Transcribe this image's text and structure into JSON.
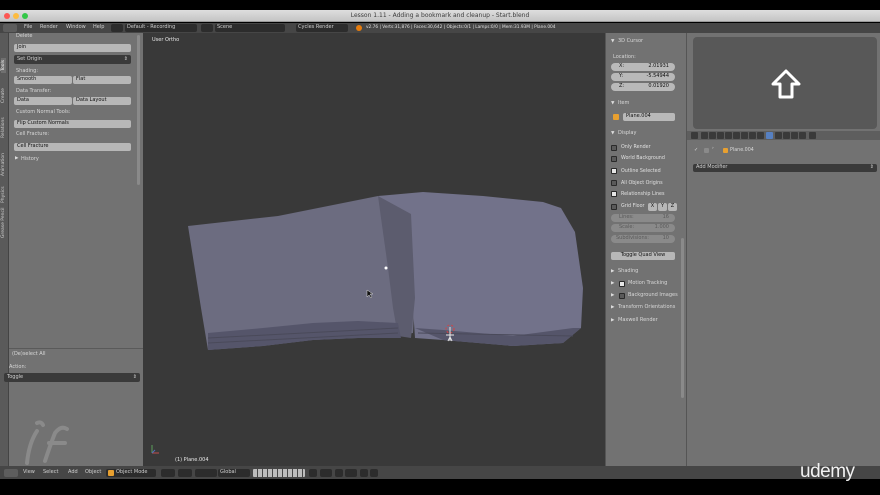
{
  "window": {
    "title": "Lesson 1.11 - Adding a bookmark and cleanup - Start.blend"
  },
  "colors": {
    "accent": "#5680c2",
    "panel": "#727272",
    "viewport": "#393939",
    "header": "#2a2a2a",
    "button": "#b7b7b7"
  },
  "info_header": {
    "menus": [
      "File",
      "Render",
      "Window",
      "Help"
    ],
    "layout": "Default - Recording",
    "scene": "Scene",
    "engine": "Cycles Render",
    "stats": "v2.76 | Verts:31,876 | Faces:30,642 | Objects:0/1 | Lamps:0/0 | Mem:31.93M | Plane.004"
  },
  "toolshelf": {
    "tabs": [
      "Tools",
      "Create",
      "Relations",
      "Animation",
      "Physics",
      "Grease Pencil"
    ],
    "delete_label": "Delete",
    "join_label": "Join",
    "set_origin_label": "Set Origin",
    "shading_label": "Shading:",
    "smooth_label": "Smooth",
    "flat_label": "Flat",
    "data_transfer_label": "Data Transfer:",
    "data_label": "Data",
    "data_layout_label": "Data Layout",
    "custom_normal_label": "Custom Normal Tools:",
    "flip_normals_label": "Flip Custom Normals",
    "cell_fracture_label": "Cell Fracture:",
    "cell_fracture_button": "Cell Fracture",
    "history_label": "History",
    "operator_title": "(De)select All",
    "action_label": "Action:",
    "action_value": "Toggle"
  },
  "viewport": {
    "view_label": "User Ortho",
    "object_label": "(1) Plane.004"
  },
  "view3d_header": {
    "menus": [
      "View",
      "Select",
      "Add",
      "Object"
    ],
    "mode": "Object Mode",
    "orientation": "Global"
  },
  "properties": {
    "cursor_header": "3D Cursor",
    "location_label": "Location:",
    "x_label": "X:",
    "x_value": "2.01931",
    "y_label": "Y:",
    "y_value": "-5.54944",
    "z_label": "Z:",
    "z_value": "0.01920",
    "item_header": "Item",
    "item_name": "Plane.004",
    "display_header": "Display",
    "only_render": "Only Render",
    "world_background": "World Background",
    "outline_selected": "Outline Selected",
    "all_object_origins": "All Object Origins",
    "relationship_lines": "Relationship Lines",
    "grid_floor": "Grid Floor",
    "axis_x": "X",
    "axis_y": "Y",
    "axis_z": "Z",
    "lines_label": "Lines:",
    "lines_value": "16",
    "scale_label": "Scale:",
    "scale_value": "1.000",
    "subdivisions_label": "Subdivisions:",
    "subdivisions_value": "10",
    "toggle_quad_view": "Toggle Quad View",
    "shading_header": "Shading",
    "motion_tracking": "Motion Tracking",
    "background_images": "Background Images",
    "transform_orientations": "Transform Orientations",
    "maxwell_render": "Maxwell Render"
  },
  "modifiers": {
    "object_name": "Plane.004",
    "add_modifier": "Add Modifier"
  },
  "watermark": {
    "brand": "udemy"
  }
}
